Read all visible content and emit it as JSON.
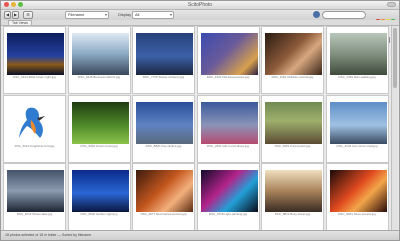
{
  "window": {
    "title": "ScitoPhoto"
  },
  "toolbar": {
    "back_label": "◀",
    "forward_label": "▶",
    "view_label": "☰",
    "sort_label": "Filename",
    "filter_label": "Display",
    "filter_value": "All",
    "color_labels": [
      "#e33b3b",
      "#f28b2b",
      "#f2d12b",
      "#49b84a",
      "#3f6fd1",
      "#9b55c9",
      "#8b8b8b"
    ]
  },
  "tab": {
    "label": "Tab Views"
  },
  "thumbnails": [
    {
      "caption": "DSC_9134 Eiffel-tower-night.jpg",
      "bg": "linear-gradient(#0b1d5c,#2541a0 55%,#8a5a1a 75%,#0a0f2a)"
    },
    {
      "caption": "DSC_0215 Business-district.jpg",
      "bg": "linear-gradient(#dfe9f3,#8aa9c4 50%,#39475a)"
    },
    {
      "caption": "DSC_7735 Statue-of-liberty.jpg",
      "bg": "linear-gradient(#25407a,#3c61a7 55%,#1b2540)"
    },
    {
      "caption": "DSC_4422 Old-street-lamps.jpg",
      "bg": "linear-gradient(135deg,#3b4bb0,#6a5a99 45%,#d7a04e 80%,#2b1f44)"
    },
    {
      "caption": "DSC_1160 Children-portrait.jpg",
      "bg": "linear-gradient(135deg,#2a1b12,#8b5a3a 45%,#d6a77f 65%,#3a2418)"
    },
    {
      "caption": "DSC_3391 Man-walking.jpg",
      "bg": "linear-gradient(#b9c7bb,#7b8a79 55%,#3f4a3c)"
    },
    {
      "caption": "DSC_5012 Kingfisher-bird.jpg",
      "bg": "linear-gradient(#ffffff,#ffffff)"
    },
    {
      "caption": "DSC_6634 Green-forest.jpg",
      "bg": "linear-gradient(#1f3b12,#4e8a2a 55%,#8dc24a)"
    },
    {
      "caption": "DSC_8820 City-skyline.jpg",
      "bg": "linear-gradient(#2a4f99,#5f82c2 55%,#5a6a7c)"
    },
    {
      "caption": "DSC_2451 Girl-in-red-dress.jpg",
      "bg": "linear-gradient(#3a5a9a,#8b94b8 55%,#b64a6e)"
    },
    {
      "caption": "DSC_0991 Forest-path.jpg",
      "bg": "linear-gradient(#6f8a52,#9fb06c 45%,#5a4b33)"
    },
    {
      "caption": "DSC_4104 Car-mirror-road.jpg",
      "bg": "linear-gradient(#5e8fc7,#9fc1e3 55%,#3a4a60)"
    },
    {
      "caption": "DSC_3212 Winter-lake.jpg",
      "bg": "linear-gradient(#44536a,#8c9bb0 50%,#1c2433)"
    },
    {
      "caption": "DSC_5540 Harbor-night.jpg",
      "bg": "linear-gradient(#0b2b8a,#2a66d4 55%,#0a1740)"
    },
    {
      "caption": "DSC_6677 Red-haired-woman.jpg",
      "bg": "linear-gradient(135deg,#3a1a0c,#c4571f 45%,#f2b07c 70%,#5a2a10)"
    },
    {
      "caption": "DSC_7018 Light-painting.jpg",
      "bg": "linear-gradient(135deg,#120a2a,#b2238a 40%,#22a0d8 65%,#0a0a18)"
    },
    {
      "caption": "DSC_8812 Busy-street.jpg",
      "bg": "linear-gradient(#f0e0c0,#a8825a 50%,#3a2c24)"
    },
    {
      "caption": "DSC_9941 Neon-streets.jpg",
      "bg": "linear-gradient(135deg,#1a0a0a,#e04a1f 45%,#f2a54a 65%,#2a0a0a)"
    }
  ],
  "status": {
    "text": "18 photos selected of 18 in folder — Sorted by filename"
  }
}
